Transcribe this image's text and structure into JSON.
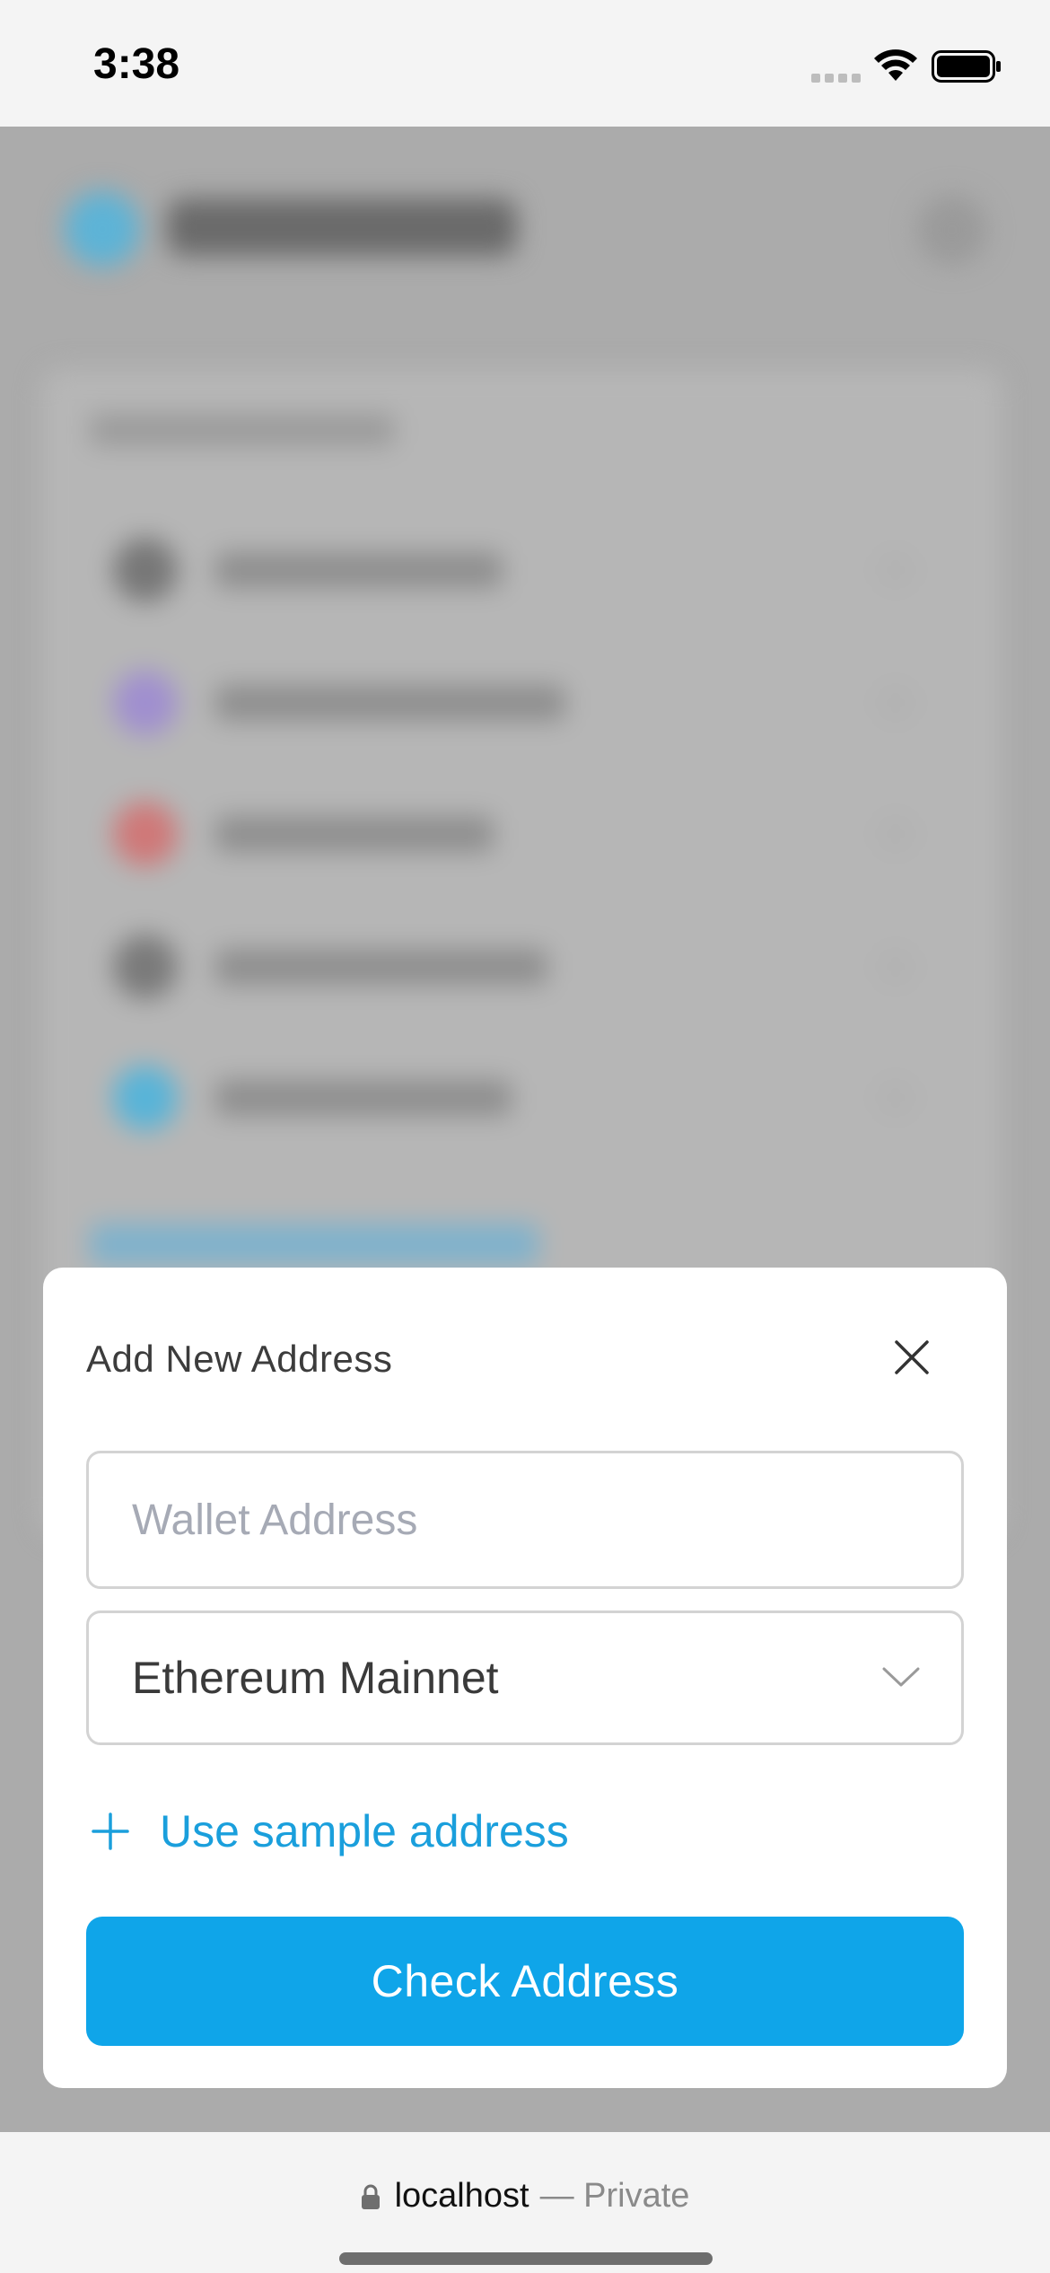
{
  "status_bar": {
    "time": "3:38"
  },
  "modal": {
    "title": "Add New Address",
    "wallet_input": {
      "value": "",
      "placeholder": "Wallet Address"
    },
    "network_select": {
      "selected": "Ethereum Mainnet"
    },
    "sample_link_label": "Use sample address",
    "submit_label": "Check Address"
  },
  "browser": {
    "host": "localhost",
    "privacy": "— Private"
  },
  "colors": {
    "accent": "#0fa5e9",
    "link": "#1a9fdc",
    "overlay": "#ababab"
  },
  "icons": {
    "close": "close-icon",
    "chevron": "chevron-down-icon",
    "add": "plus-icon",
    "lock": "lock-icon"
  }
}
